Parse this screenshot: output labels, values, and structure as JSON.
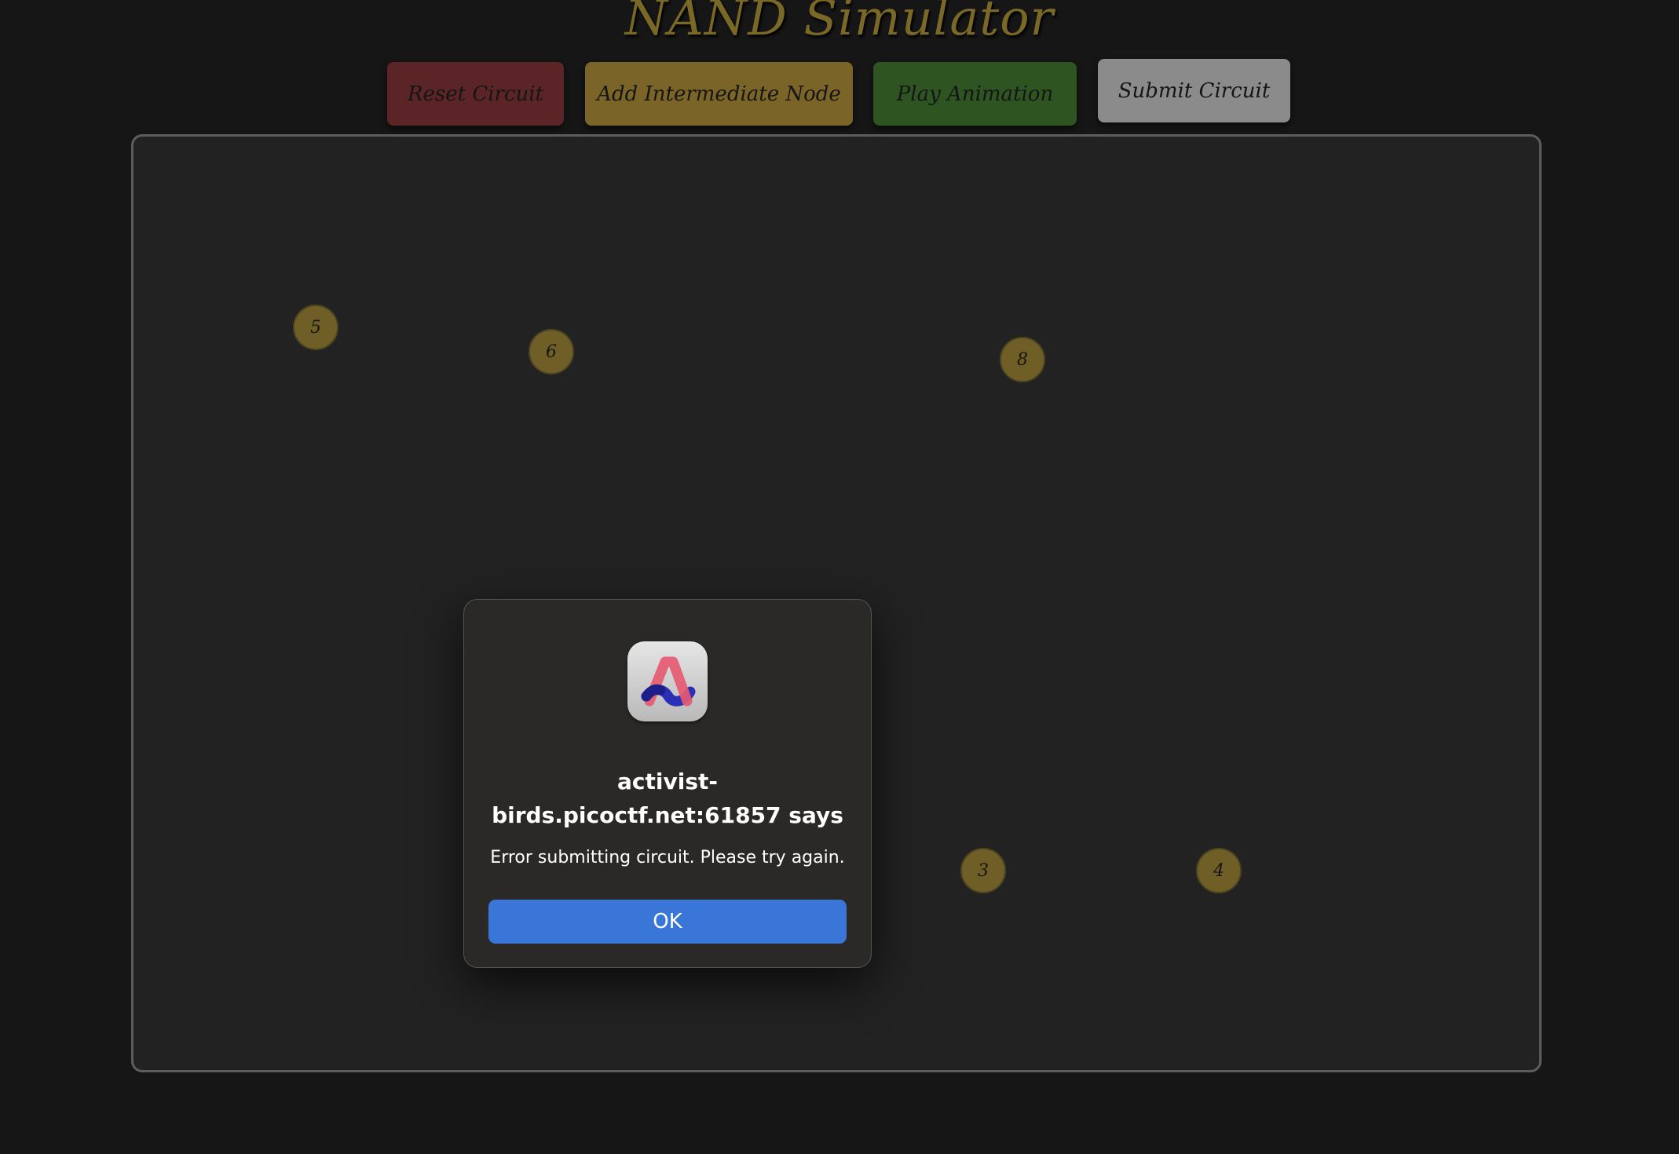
{
  "page": {
    "title": "NAND Simulator"
  },
  "toolbar": {
    "reset_label": "Reset Circuit",
    "add_node_label": "Add Intermediate Node",
    "play_label": "Play Animation",
    "submit_label": "Submit Circuit"
  },
  "nodes": [
    {
      "label": "5"
    },
    {
      "label": "6"
    },
    {
      "label": "8"
    },
    {
      "label": "3"
    },
    {
      "label": "4"
    }
  ],
  "dialog": {
    "title": "activist-birds.picoctf.net:61857 says",
    "message": "Error submitting circuit. Please try again.",
    "ok_label": "OK",
    "icon": "arc-browser-icon"
  },
  "colors": {
    "background": "#161616",
    "board": "#222222",
    "gold": "#7a6827",
    "reset": "#5b2528",
    "add": "#7a6427",
    "play": "#2d5421",
    "submit": "#8b8b8b",
    "ok": "#3a76d8"
  }
}
